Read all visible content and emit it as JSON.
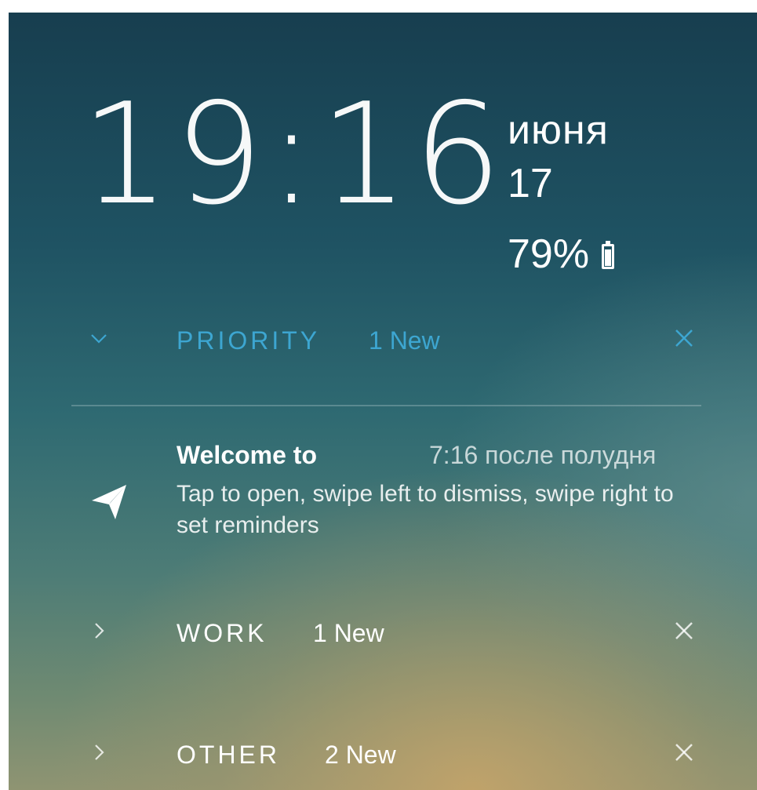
{
  "lockscreen": {
    "clock": "19:16",
    "date_month": "июня",
    "date_day": "17",
    "battery_percent": "79%",
    "battery_level": 0.79
  },
  "sections": [
    {
      "title": "PRIORITY",
      "count": "1 New",
      "expanded": true,
      "color": "#3da6d1"
    },
    {
      "title": "WORK",
      "count": "1 New",
      "expanded": false
    },
    {
      "title": "OTHER",
      "count": "2 New",
      "expanded": false
    }
  ],
  "notification": {
    "icon": "paper-plane-icon",
    "title": "Welcome to",
    "time": "7:16 после полудня",
    "body": "Tap to open, swipe left to dismiss, swipe right to set reminders"
  },
  "icons": {
    "expanded": "chevron-down-icon",
    "collapsed": "chevron-right-icon",
    "close": "close-icon",
    "battery": "battery-icon"
  }
}
